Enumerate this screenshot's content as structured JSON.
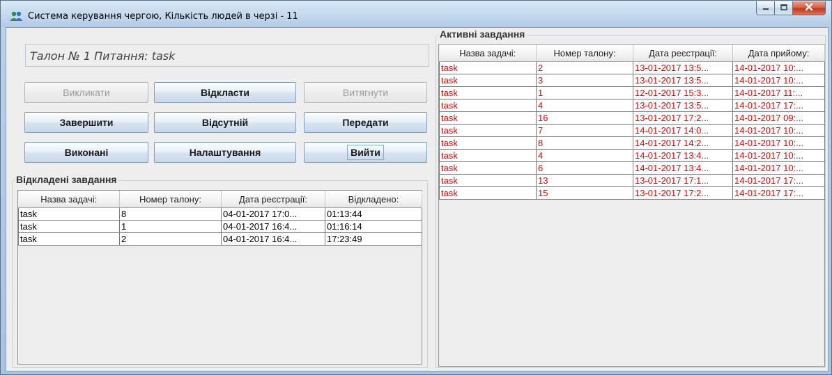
{
  "window": {
    "title": "Система керування чергою,  Кількість людей в черзі - 11"
  },
  "talon": {
    "text": "Талон № 1   Питання: task"
  },
  "buttons": {
    "call": "Викликати",
    "postpone": "Відкласти",
    "pull": "Витягнути",
    "finish": "Завершити",
    "absent": "Відсутній",
    "transfer": "Передати",
    "done": "Виконані",
    "settings": "Налаштування",
    "exit": "Вийти"
  },
  "postponed": {
    "title": "Відкладені завдання",
    "columns": [
      "Назва задачі:",
      "Номер талону:",
      "Дата реєстрації:",
      "Відкладено:"
    ],
    "rows": [
      [
        "task",
        "8",
        "04-01-2017 17:0...",
        "01:13:44"
      ],
      [
        "task",
        "1",
        "04-01-2017 16:4...",
        "01:16:14"
      ],
      [
        "task",
        "2",
        "04-01-2017 16:4...",
        "17:23:49"
      ]
    ]
  },
  "active": {
    "title": "Активні завдання",
    "columns": [
      "Назва задачі:",
      "Номер талону:",
      "Дата реєстрації:",
      "Дата прийому:"
    ],
    "rows": [
      [
        "task",
        "2",
        "13-01-2017 13:5...",
        "14-01-2017 10:..."
      ],
      [
        "task",
        "3",
        "13-01-2017 13:5...",
        "14-01-2017 10:..."
      ],
      [
        "task",
        "1",
        "12-01-2017 15:3...",
        "14-01-2017 11:..."
      ],
      [
        "task",
        "4",
        "13-01-2017 13:5...",
        "14-01-2017 17:..."
      ],
      [
        "task",
        "16",
        "13-01-2017 17:2...",
        "14-01-2017 09:..."
      ],
      [
        "task",
        "7",
        "14-01-2017 14:0...",
        "14-01-2017 10:..."
      ],
      [
        "task",
        "8",
        "14-01-2017 14:2...",
        "14-01-2017 10:..."
      ],
      [
        "task",
        "4",
        "14-01-2017 13:4...",
        "14-01-2017 10:..."
      ],
      [
        "task",
        "6",
        "14-01-2017 13:4...",
        "14-01-2017 10:..."
      ],
      [
        "task",
        "13",
        "13-01-2017 17:1...",
        "14-01-2017 17:..."
      ],
      [
        "task",
        "15",
        "13-01-2017 17:2...",
        "14-01-2017 17:..."
      ]
    ]
  },
  "colors": {
    "active_text": "#ee0000",
    "titlebar": "#c3d7ee"
  },
  "icons": {
    "app": "users-icon",
    "minimize": "minimize-icon",
    "maximize": "maximize-icon",
    "close": "close-icon"
  }
}
